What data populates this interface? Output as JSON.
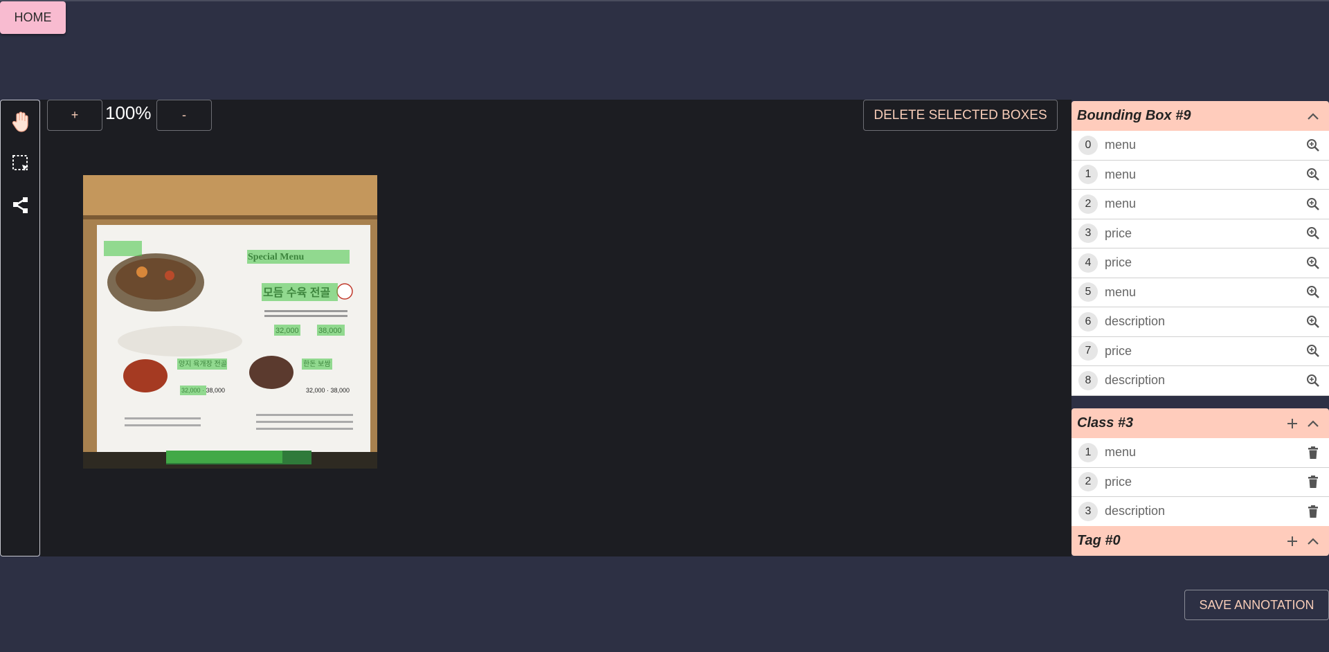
{
  "nav": {
    "home_label": "HOME"
  },
  "canvas": {
    "zoom_in_label": "+",
    "zoom_out_label": "-",
    "zoom_level": "100%",
    "delete_label": "DELETE SELECTED BOXES"
  },
  "tools": [
    "hand-icon",
    "box-select-icon",
    "polygon-icon"
  ],
  "bounding_boxes": {
    "title": "Bounding Box #9",
    "items": [
      {
        "index": "0",
        "label": "menu"
      },
      {
        "index": "1",
        "label": "menu"
      },
      {
        "index": "2",
        "label": "menu"
      },
      {
        "index": "3",
        "label": "price"
      },
      {
        "index": "4",
        "label": "price"
      },
      {
        "index": "5",
        "label": "menu"
      },
      {
        "index": "6",
        "label": "description"
      },
      {
        "index": "7",
        "label": "price"
      },
      {
        "index": "8",
        "label": "description"
      }
    ]
  },
  "classes": {
    "title": "Class #3",
    "items": [
      {
        "index": "1",
        "label": "menu"
      },
      {
        "index": "2",
        "label": "price"
      },
      {
        "index": "3",
        "label": "description"
      }
    ]
  },
  "tags": {
    "title": "Tag #0"
  },
  "save_label": "SAVE ANNOTATION",
  "colors": {
    "background": "#2d3044",
    "canvas": "#1c1d22",
    "panel_header": "#ffccbc",
    "accent_text": "#f8cdb8",
    "home_button": "#f8bbd0"
  }
}
